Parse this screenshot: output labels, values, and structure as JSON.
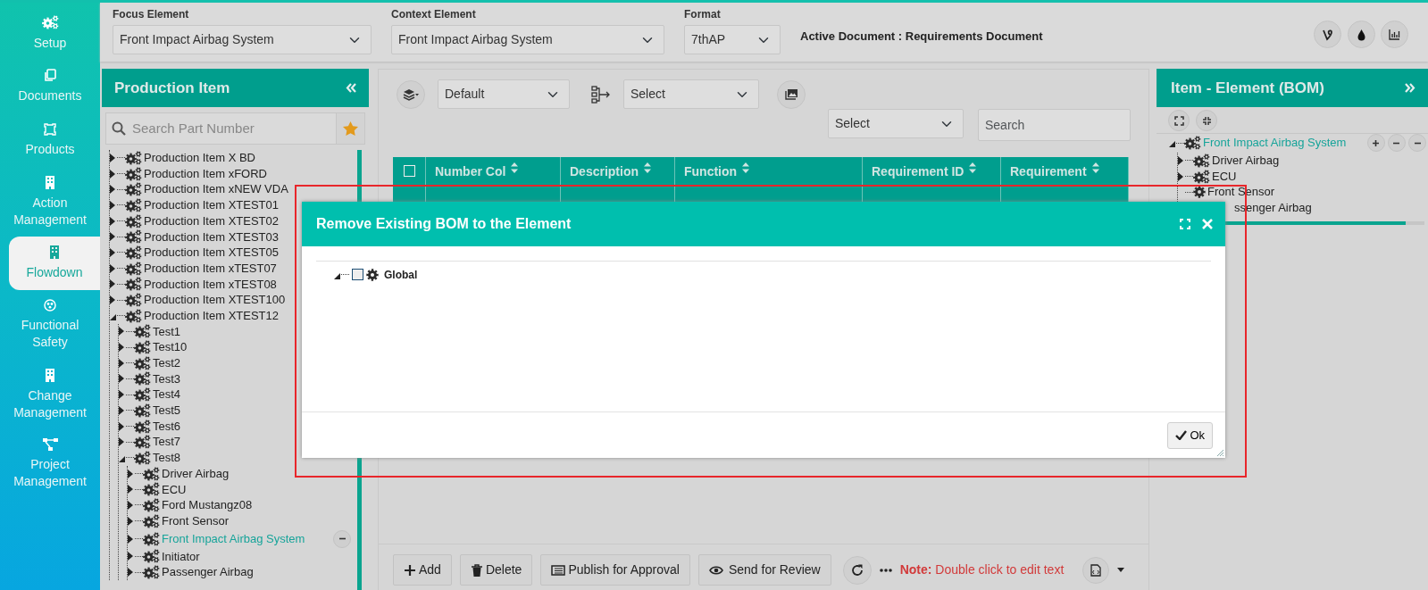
{
  "sidebar": {
    "items": [
      {
        "label": "Setup",
        "kind": "gears",
        "selected": false
      },
      {
        "label": "Documents",
        "kind": "docs",
        "selected": false
      },
      {
        "label": "Products",
        "kind": "product",
        "selected": false
      },
      {
        "label": "Action Management",
        "kind": "building",
        "selected": false
      },
      {
        "label": "Flowdown",
        "kind": "building",
        "selected": true
      },
      {
        "label": "Functional Safety",
        "kind": "hazard",
        "selected": false
      },
      {
        "label": "Change Management",
        "kind": "building",
        "selected": false
      },
      {
        "label": "Project Management",
        "kind": "network",
        "selected": false
      }
    ]
  },
  "top_bar": {
    "fields": [
      {
        "label": "Focus Element",
        "value": "Front Impact Airbag System"
      },
      {
        "label": "Context Element",
        "value": "Front Impact Airbag System"
      },
      {
        "label": "Format",
        "value": "7thAP"
      }
    ],
    "active_document": "Active Document : Requirements Document"
  },
  "production_panel": {
    "title": "Production Item",
    "search": {
      "placeholder": "Search Part Number"
    },
    "tree": [
      {
        "label": "Production Item X BD",
        "expanded": false,
        "selected": false
      },
      {
        "label": "Production Item xFORD",
        "expanded": false,
        "selected": false
      },
      {
        "label": "Production Item xNEW VDA",
        "expanded": false,
        "selected": false
      },
      {
        "label": "Production Item XTEST01",
        "expanded": false,
        "selected": false
      },
      {
        "label": "Production Item XTEST02",
        "expanded": false,
        "selected": false
      },
      {
        "label": "Production Item XTEST03",
        "expanded": false,
        "selected": false
      },
      {
        "label": "Production Item XTEST05",
        "expanded": false,
        "selected": false
      },
      {
        "label": "Production Item xTEST07",
        "expanded": false,
        "selected": false
      },
      {
        "label": "Production Item xTEST08",
        "expanded": false,
        "selected": false
      },
      {
        "label": "Production Item XTEST100",
        "expanded": false,
        "selected": false
      },
      {
        "label": "Production Item XTEST12",
        "expanded": true,
        "selected": false,
        "children": [
          {
            "label": "Test1",
            "expanded": false,
            "selected": false
          },
          {
            "label": "Test10",
            "expanded": false,
            "selected": false
          },
          {
            "label": "Test2",
            "expanded": false,
            "selected": false
          },
          {
            "label": "Test3",
            "expanded": false,
            "selected": false
          },
          {
            "label": "Test4",
            "expanded": false,
            "selected": false
          },
          {
            "label": "Test5",
            "expanded": false,
            "selected": false
          },
          {
            "label": "Test6",
            "expanded": false,
            "selected": false
          },
          {
            "label": "Test7",
            "expanded": false,
            "selected": false
          },
          {
            "label": "Test8",
            "expanded": true,
            "selected": false,
            "children": [
              {
                "label": "Driver Airbag",
                "expanded": false,
                "selected": false
              },
              {
                "label": "ECU",
                "expanded": false,
                "selected": false
              },
              {
                "label": "Ford Mustangz08",
                "expanded": false,
                "selected": false
              },
              {
                "label": "Front Sensor",
                "expanded": false,
                "selected": false
              },
              {
                "label": "Front Impact Airbag System",
                "expanded": false,
                "selected": true,
                "buttons": [
                  {
                    "kind": "remove"
                  }
                ]
              },
              {
                "label": "Initiator",
                "expanded": false,
                "selected": false
              },
              {
                "label": "Passenger Airbag",
                "expanded": false,
                "selected": false
              }
            ]
          }
        ]
      }
    ]
  },
  "center": {
    "view_select": "Default",
    "hierarchy_select": "Select",
    "filter_select": "Select",
    "search": {
      "placeholder": "Search"
    },
    "table": {
      "select_all_checked": false,
      "columns": [
        "Number Col",
        "Description",
        "Function",
        "Requirement ID",
        "Requirement"
      ]
    },
    "actions": [
      {
        "label": "Add",
        "kind": "add"
      },
      {
        "label": "Delete",
        "kind": "delete"
      },
      {
        "label": "Publish for Approval",
        "kind": "publish"
      },
      {
        "label": "Send for Review",
        "kind": "review"
      }
    ],
    "note": "**Note:** Double click to edit text"
  },
  "bom_panel": {
    "title": "Item - Element (BOM)",
    "tree": [
      {
        "label": "Front Impact Airbag System",
        "expanded": true,
        "selected": true,
        "buttons": [
          {
            "kind": "add"
          },
          {
            "kind": "remove"
          },
          {
            "kind": "remove"
          }
        ],
        "children": [
          {
            "label": "Driver Airbag",
            "expanded": false
          },
          {
            "label": "ECU",
            "expanded": false
          },
          {
            "label": "Front Sensor",
            "kind": "part"
          },
          {
            "label": "ssenger Airbag",
            "kind": "partial"
          }
        ]
      }
    ]
  },
  "modal": {
    "title": "Remove Existing BOM to the Element",
    "tree": [
      {
        "label": "Global",
        "expanded": true,
        "checked": false
      }
    ],
    "ok_button": "Ok"
  }
}
